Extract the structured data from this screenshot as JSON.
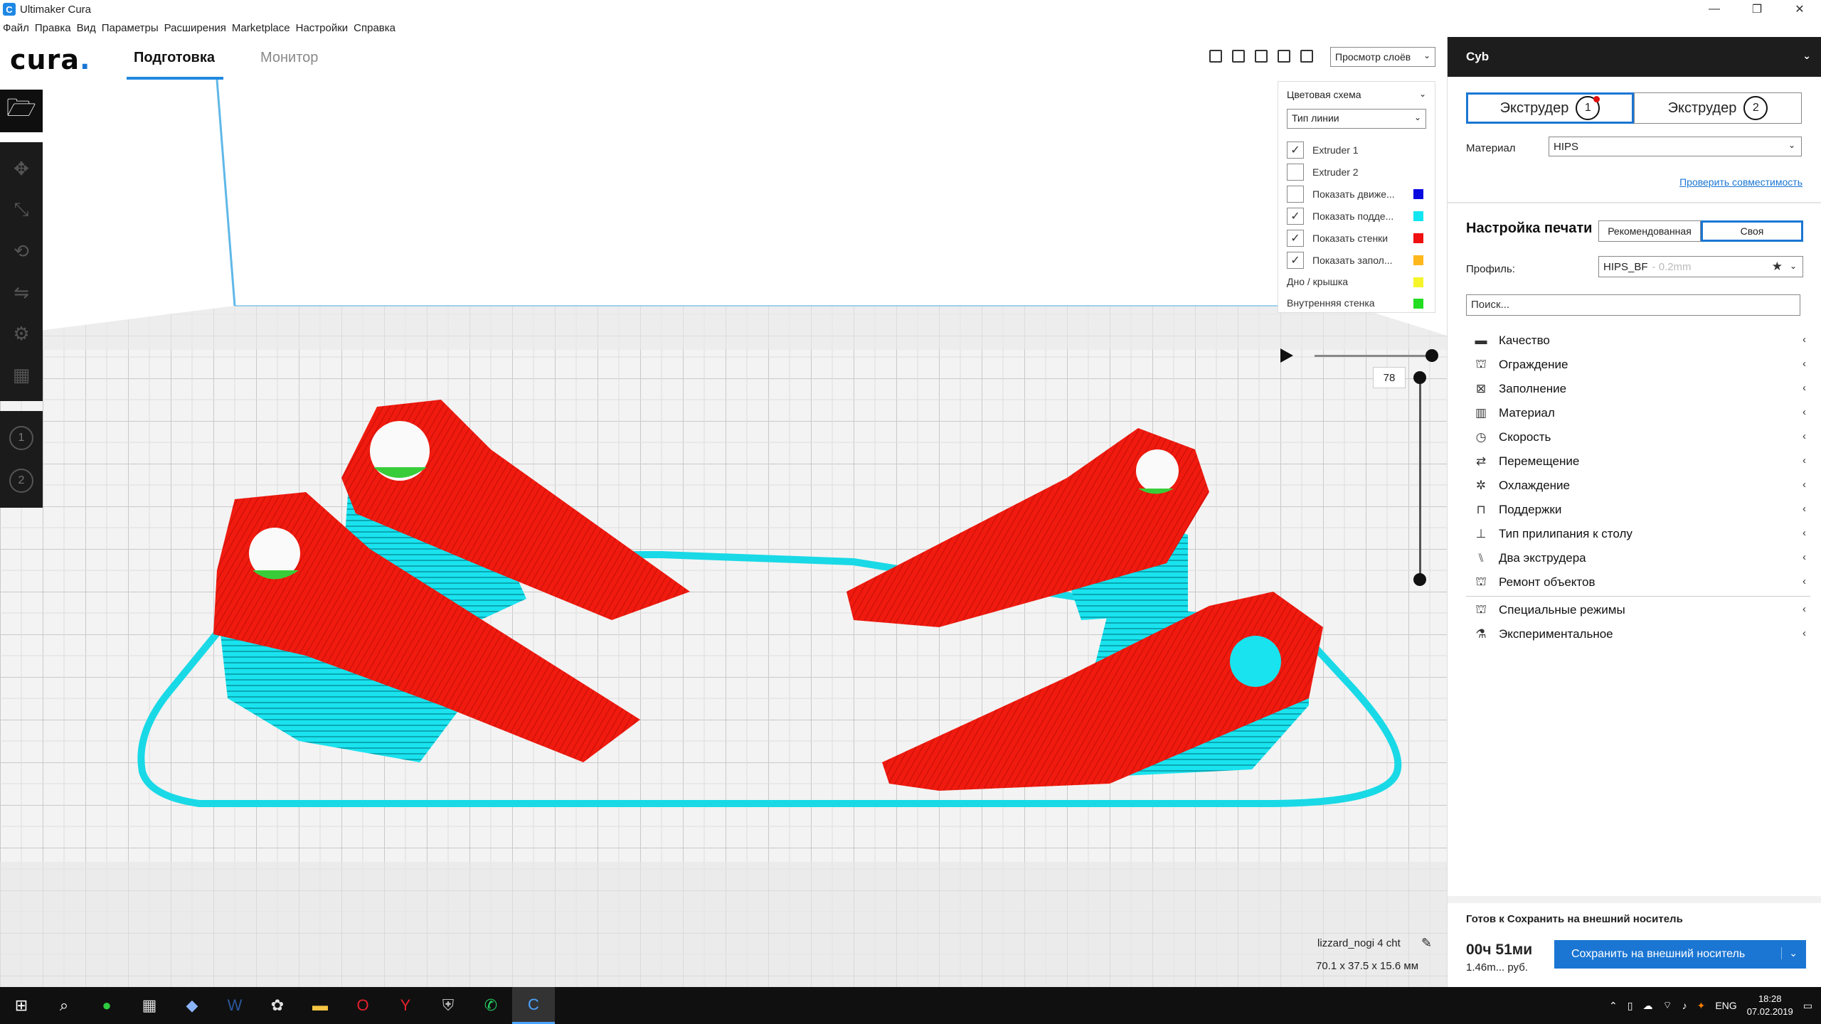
{
  "window": {
    "title": "Ultimaker Cura",
    "controls": [
      "—",
      "❐",
      "✕"
    ]
  },
  "menu": [
    "Файл",
    "Правка",
    "Вид",
    "Параметры",
    "Расширения",
    "Marketplace",
    "Настройки",
    "Справка"
  ],
  "header": {
    "logo": "cura",
    "logo_dot": ".",
    "tab_prepare": "Подготовка",
    "tab_monitor": "Монитор"
  },
  "view": {
    "mode": "Просмотр слоёв"
  },
  "color_scheme": {
    "title": "Цветовая схема",
    "selected": "Тип линии",
    "items": [
      {
        "label": "Extruder 1",
        "checked": true,
        "color": ""
      },
      {
        "label": "Extruder 2",
        "checked": false,
        "color": ""
      },
      {
        "label": "Показать движе...",
        "checked": false,
        "color": "#0a0ae0"
      },
      {
        "label": "Показать подде...",
        "checked": true,
        "color": "#12e6f0"
      },
      {
        "label": "Показать стенки",
        "checked": true,
        "color": "#f01010"
      },
      {
        "label": "Показать запол...",
        "checked": true,
        "color": "#ffb81c"
      }
    ],
    "legend": [
      {
        "label": "Дно / крышка",
        "color": "#f5f52a"
      },
      {
        "label": "Внутренняя стенка",
        "color": "#22dd22"
      }
    ]
  },
  "layer": {
    "current": "78"
  },
  "object": {
    "name": "lizzard_nogi 4 cht",
    "dims": "70.1 x 37.5 x 15.6 мм"
  },
  "panel": {
    "title": "Cyb",
    "extruder1": "Экструдер",
    "extruder1_num": "1",
    "extruder2": "Экструдер",
    "extruder2_num": "2",
    "material_label": "Материал",
    "material_value": "HIPS",
    "compat_link": "Проверить совместимость",
    "print_setup": "Настройка печати",
    "mode_recommended": "Рекомендованная",
    "mode_custom": "Своя",
    "profile_label": "Профиль:",
    "profile_value": "HIPS_BF",
    "profile_layer": "- 0.2mm",
    "search_placeholder": "Поиск...",
    "categories": [
      {
        "label": "Качество",
        "icon": "quality-icon",
        "glyph": "▬"
      },
      {
        "label": "Ограждение",
        "icon": "shell-icon",
        "glyph": "⛫"
      },
      {
        "label": "Заполнение",
        "icon": "infill-icon",
        "glyph": "⊠"
      },
      {
        "label": "Материал",
        "icon": "material-icon",
        "glyph": "▥"
      },
      {
        "label": "Скорость",
        "icon": "speed-icon",
        "glyph": "◷"
      },
      {
        "label": "Перемещение",
        "icon": "travel-icon",
        "glyph": "⇄"
      },
      {
        "label": "Охлаждение",
        "icon": "cooling-icon",
        "glyph": "✲"
      },
      {
        "label": "Поддержки",
        "icon": "support-icon",
        "glyph": "⊓"
      },
      {
        "label": "Тип прилипания к столу",
        "icon": "adhesion-icon",
        "glyph": "⊥"
      },
      {
        "label": "Два экструдера",
        "icon": "dual-icon",
        "glyph": "⑊"
      },
      {
        "label": "Ремонт объектов",
        "icon": "mesh-fix-icon",
        "glyph": "⛫"
      }
    ],
    "categories2": [
      {
        "label": "Специальные режимы",
        "icon": "special-modes-icon",
        "glyph": "⛫"
      },
      {
        "label": "Экспериментальное",
        "icon": "experimental-icon",
        "glyph": "⚗"
      }
    ],
    "ready": "Готов к Сохранить на внешний носитель",
    "time": "00ч 51ми",
    "cost": "1.46m... руб.",
    "save": "Сохранить на внешний носитель"
  },
  "taskbar": {
    "lang": "ENG",
    "time": "18:28",
    "date": "07.02.2019"
  },
  "colors": {
    "accent": "#1b76d3",
    "wall": "#f01010",
    "support": "#12e6f0"
  }
}
